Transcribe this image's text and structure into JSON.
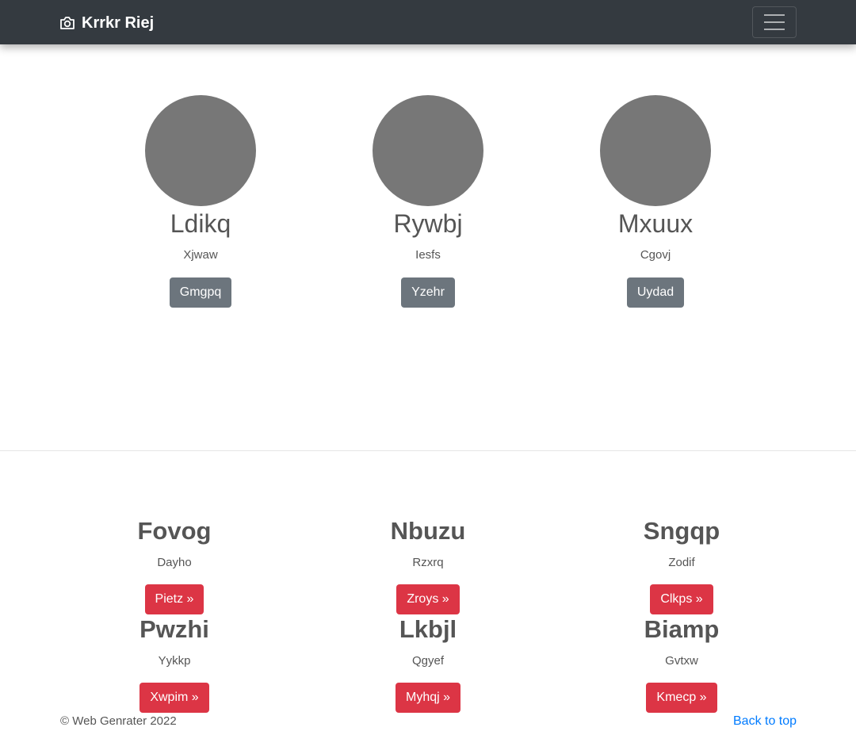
{
  "navbar": {
    "brand": "Krrkr Riej",
    "brand_icon": "camera-icon",
    "toggler_icon": "hamburger-menu-icon"
  },
  "profiles": [
    {
      "name": "Ldikq",
      "subtitle": "Xjwaw",
      "button": "Gmgpq"
    },
    {
      "name": "Rywbj",
      "subtitle": "Iesfs",
      "button": "Yzehr"
    },
    {
      "name": "Mxuux",
      "subtitle": "Cgovj",
      "button": "Uydad"
    }
  ],
  "features": [
    {
      "title": "Fovog",
      "subtitle": "Dayho",
      "button": "Pietz »"
    },
    {
      "title": "Nbuzu",
      "subtitle": "Rzxrq",
      "button": "Zroys »"
    },
    {
      "title": "Sngqp",
      "subtitle": "Zodif",
      "button": "Clkps »"
    },
    {
      "title": "Pwzhi",
      "subtitle": "Yykkp",
      "button": "Xwpim »"
    },
    {
      "title": "Lkbjl",
      "subtitle": "Qgyef",
      "button": "Myhqj »"
    },
    {
      "title": "Biamp",
      "subtitle": "Gvtxw",
      "button": "Kmecp »"
    }
  ],
  "footer": {
    "copyright": "© Web Genrater 2022",
    "back_to_top": "Back to top"
  },
  "colors": {
    "navbar": "#343a40",
    "avatar": "#777777",
    "button_secondary": "#6c757d",
    "button_danger": "#dc3545",
    "link": "#007bff"
  }
}
